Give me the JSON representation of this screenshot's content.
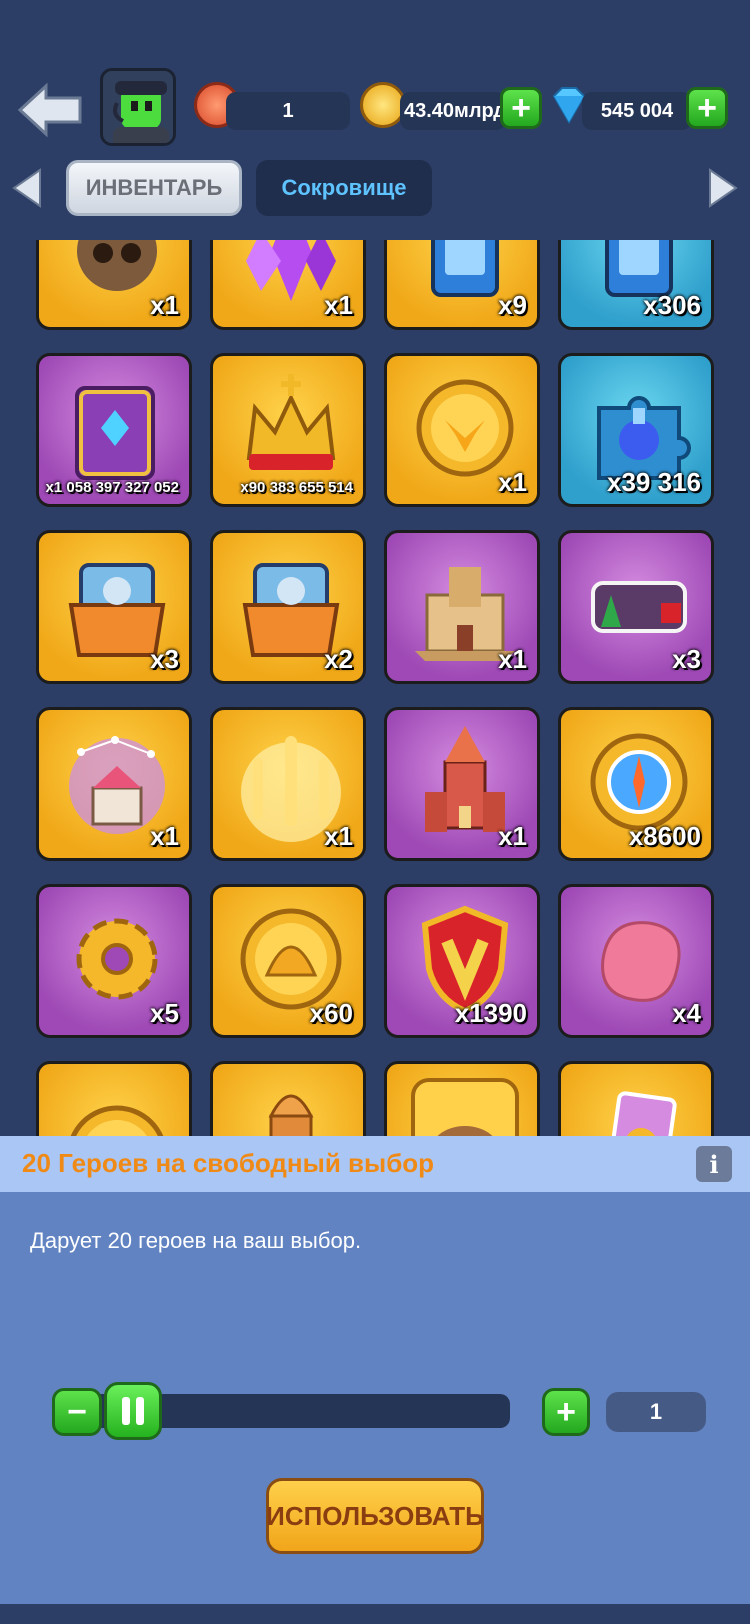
{
  "header": {
    "back_icon": "back-arrow-icon",
    "avatar_icon": "green-robot-avatar-icon",
    "level_icon": "badge-icon",
    "level_value": "1",
    "gold_icon": "gold-coin-icon",
    "gold_value": "43.40млрд",
    "gems_icon": "diamond-icon",
    "gems_value": "545 004"
  },
  "tabs": {
    "inventory_label": "ИНВЕНТАРЬ",
    "treasure_label": "Сокровище"
  },
  "items": [
    {
      "count": "x1",
      "color": "gold",
      "icon": "hooded-head-icon"
    },
    {
      "count": "x1",
      "color": "gold",
      "icon": "purple-crystal-icon"
    },
    {
      "count": "x9",
      "color": "gold",
      "icon": "blue-card-icon"
    },
    {
      "count": "x306",
      "color": "blue",
      "icon": "blue-card-icon"
    },
    {
      "count": "x1 058 397 327 052",
      "color": "purple",
      "icon": "spell-book-icon"
    },
    {
      "count": "x90 383 655 514",
      "color": "gold",
      "icon": "crown-icon"
    },
    {
      "count": "x1",
      "color": "gold",
      "icon": "wing-coin-icon"
    },
    {
      "count": "x39 316",
      "color": "blue",
      "icon": "puzzle-potion-icon"
    },
    {
      "count": "x3",
      "color": "gold",
      "icon": "card-chest-icon"
    },
    {
      "count": "x2",
      "color": "gold",
      "icon": "card-chest-icon"
    },
    {
      "count": "x1",
      "color": "purple",
      "icon": "desert-castle-icon"
    },
    {
      "count": "x3",
      "color": "purple",
      "icon": "christmas-frame-icon"
    },
    {
      "count": "x1",
      "color": "gold",
      "icon": "constellation-castle-icon"
    },
    {
      "count": "x1",
      "color": "gold",
      "icon": "swords-icon"
    },
    {
      "count": "x1",
      "color": "purple",
      "icon": "red-tower-icon"
    },
    {
      "count": "x8600",
      "color": "gold",
      "icon": "compass-gem-icon"
    },
    {
      "count": "x5",
      "color": "purple",
      "icon": "gear-icon"
    },
    {
      "count": "x60",
      "color": "gold",
      "icon": "shell-coin-icon"
    },
    {
      "count": "x1390",
      "color": "purple",
      "icon": "v-shield-icon"
    },
    {
      "count": "x4",
      "color": "purple",
      "icon": "pink-stone-icon"
    },
    {
      "count": "",
      "color": "gold",
      "icon": "gold-token-icon"
    },
    {
      "count": "",
      "color": "gold",
      "icon": "bullet-icon"
    },
    {
      "count": "",
      "color": "gold",
      "icon": "capybara-icon"
    },
    {
      "count": "",
      "color": "gold",
      "icon": "purple-ticket-icon"
    }
  ],
  "detail": {
    "title": "20 Героев на свободный выбор",
    "info_label": "i",
    "description": "Дарует 20 героев на ваш выбор.",
    "quantity": "1",
    "minus_label": "−",
    "plus_label": "+",
    "use_label": "ИСПОЛЬЗОВАТЬ"
  }
}
